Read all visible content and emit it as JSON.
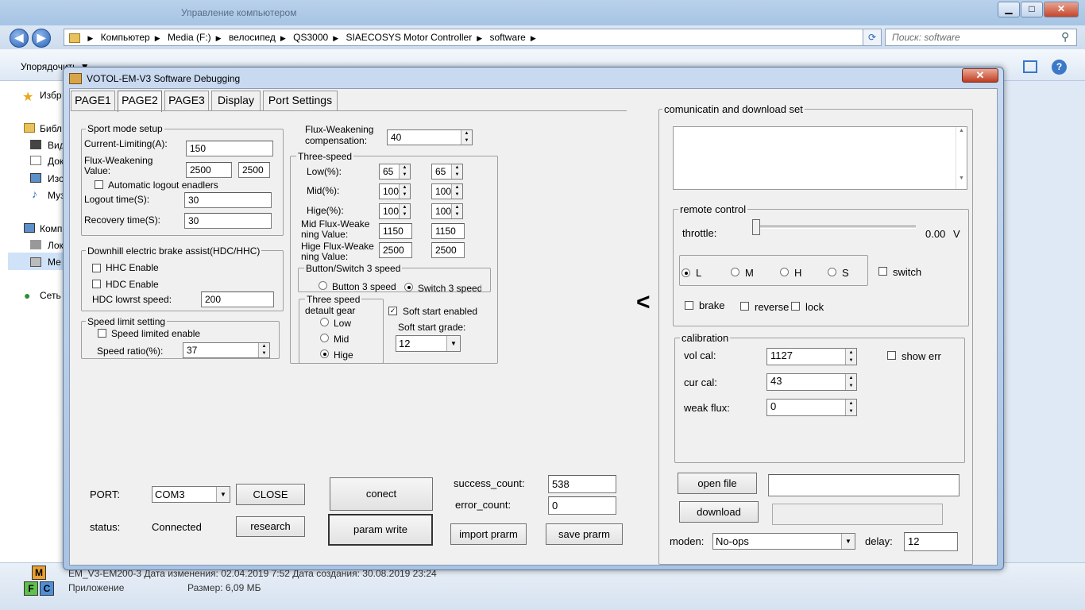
{
  "explorer": {
    "title": "Управление компьютером",
    "min": "▁",
    "max": "□",
    "close": "✕",
    "back": "◀",
    "forward": "▶",
    "breadcrumbs": [
      "Компьютер",
      "Media (F:)",
      "велосипед",
      "QS3000",
      "SIAECOSYS Motor Controller",
      "software"
    ],
    "search_placeholder": "Поиск: software",
    "toolbar_organize": "Упорядочить ▼",
    "sidebar": [
      "Избр",
      "Библ",
      "Вид",
      "Док",
      "Изо",
      "Муз",
      "Комп",
      "Лок",
      "Ме",
      "Сеть"
    ],
    "status_line1": "EM_V3-EM200-3   Дата изменения: 02.04.2019 7:52          Дата создания: 30.08.2019 23:24",
    "status_type": "Приложение",
    "status_size": "Размер: 6,09 МБ",
    "logo_letters": [
      "M",
      "F",
      "C"
    ]
  },
  "app": {
    "title": "VOTOL-EM-V3 Software Debugging",
    "close": "✕",
    "tabs": [
      "PAGE1",
      "PAGE2",
      "PAGE3",
      "Display",
      "Port Settings"
    ],
    "sport": {
      "title": "Sport mode setup",
      "current_label": "Current-Limiting(A):",
      "current_value": "150",
      "fw_label1": "Flux-Weakening",
      "fw_label2": "Value:",
      "fw_value1": "2500",
      "fw_value2": "2500",
      "auto_logout": "Automatic logout enadlers",
      "logout_label": "Logout time(S):",
      "logout_value": "30",
      "recovery_label": "Recovery time(S):",
      "recovery_value": "30"
    },
    "downhill": {
      "title": "Downhill electric brake assist(HDC/HHC)",
      "hhc": "HHC Enable",
      "hdc": "HDC Enable",
      "speed_label": "HDC lowrst speed:",
      "speed_value": "200"
    },
    "speedlimit": {
      "title": "Speed limit setting",
      "enable": "Speed limited enable",
      "ratio_label": "Speed ratio(%):",
      "ratio_value": "37"
    },
    "fwcomp": {
      "label1": "Flux-Weakening",
      "label2": "compensation:",
      "value": "40"
    },
    "threespeed": {
      "title": "Three-speed",
      "low_label": "Low(%):",
      "low1": "65",
      "low2": "65",
      "mid_label": "Mid(%):",
      "mid1": "100",
      "mid2": "100",
      "hige_label": "Hige(%):",
      "hige1": "100",
      "hige2": "100",
      "midfw_label1": "Mid Flux-Weake",
      "midfw_label2": "ning Value:",
      "midfw1": "1150",
      "midfw2": "1150",
      "higefw_label1": "Hige Flux-Weake",
      "higefw_label2": "ning Value:",
      "higefw1": "2500",
      "higefw2": "2500",
      "bs_title": "Button/Switch 3 speed",
      "bs_button": "Button 3 speed",
      "bs_switch": "Switch 3 speed",
      "default_title1": "Three speed",
      "default_title2": "detault gear",
      "gear_low": "Low",
      "gear_mid": "Mid",
      "gear_hige": "Hige",
      "soft_start": "Soft start enabled",
      "soft_grade_label": "Soft start grade:",
      "soft_grade_value": "12"
    },
    "port": {
      "port_label": "PORT:",
      "port_value": "COM3",
      "close_btn": "CLOSE",
      "status_label": "status:",
      "status_value": "Connected",
      "research_btn": "research",
      "conect_btn": "conect",
      "param_write_btn": "param write",
      "success_label": "success_count:",
      "success_value": "538",
      "error_label": "error_count:",
      "error_value": "0",
      "import_btn": "import prarm",
      "save_btn": "save prarm"
    },
    "arrow": "<",
    "comm": {
      "title": "comunicatin and download set",
      "remote_title": "remote control",
      "throttle_label": "throttle:",
      "throttle_value": "0.00",
      "throttle_unit": "V",
      "throttle_fraction": 0.0,
      "mode_L": "L",
      "mode_M": "M",
      "mode_H": "H",
      "mode_S": "S",
      "switch": "switch",
      "brake": "brake",
      "reverse": "reverse",
      "lock": "lock",
      "calib_title": "calibration",
      "vol_label": "vol cal:",
      "vol_value": "1127",
      "cur_label": "cur cal:",
      "cur_value": "43",
      "weak_label": "weak flux:",
      "weak_value": "0",
      "show_err": "show err",
      "open_file_btn": "open file",
      "download_btn": "download",
      "moden_label": "moden:",
      "moden_value": "No-ops",
      "delay_label": "delay:",
      "delay_value": "12"
    }
  }
}
